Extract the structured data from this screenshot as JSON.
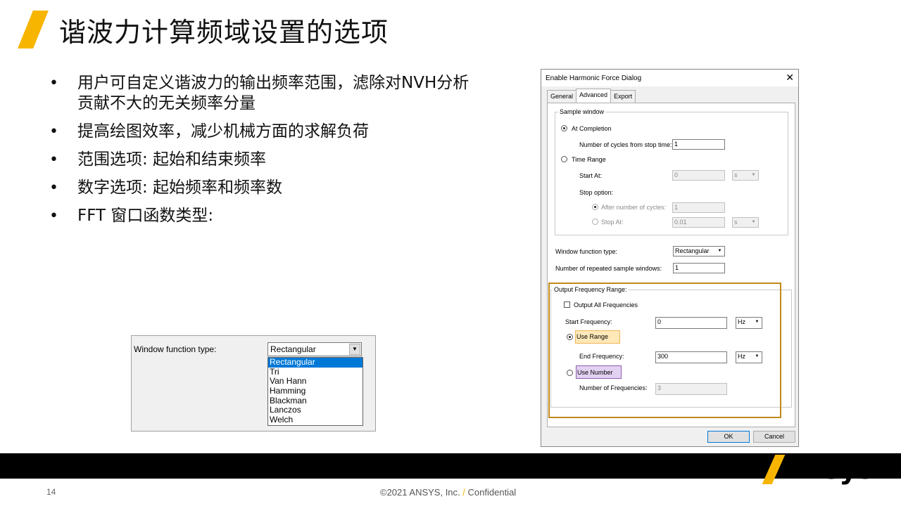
{
  "slide": {
    "title": "谐波力计算频域设置的选项",
    "bullets": [
      "用户可自定义谐波力的输出频率范围，滤除对NVH分析贡献不大的无关频率分量",
      "提高绘图效率，减少机械方面的求解负荷",
      "范围选项: 起始和结束频率",
      "数字选项: 起始频率和频率数",
      "FFT 窗口函数类型:"
    ]
  },
  "dropdown_snapshot": {
    "label": "Window function type:",
    "selected": "Rectangular",
    "options": [
      "Rectangular",
      "Tri",
      "Van Hann",
      "Hamming",
      "Blackman",
      "Lanczos",
      "Welch"
    ]
  },
  "dialog": {
    "title": "Enable Harmonic Force Dialog",
    "close_symbol": "✕",
    "tabs": [
      "General",
      "Advanced",
      "Export"
    ],
    "sample_window": {
      "caption": "Sample window",
      "at_completion": "At Completion",
      "cycles_label": "Number of cycles from stop time:",
      "cycles_value": "1",
      "time_range": "Time Range",
      "start_at_label": "Start At:",
      "start_at_value": "0",
      "start_unit": "s",
      "stop_option_label": "Stop option:",
      "after_cycles": "After number of cycles:",
      "after_cycles_value": "1",
      "stop_at": "Stop At:",
      "stop_at_value": "0.01",
      "stop_unit": "s"
    },
    "window_function_label": "Window function type:",
    "window_function_value": "Rectangular",
    "repeated_label": "Number of repeated sample windows:",
    "repeated_value": "1",
    "output_range": {
      "caption": "Output Frequency Range:",
      "output_all": "Output All Frequencies",
      "start_freq_label": "Start Frequency:",
      "start_freq_value": "0",
      "start_unit": "Hz",
      "use_range": "Use Range",
      "end_freq_label": "End Frequency:",
      "end_freq_value": "300",
      "end_unit": "Hz",
      "use_number": "Use Number",
      "num_freq_label": "Number of Frequencies:",
      "num_freq_value": "3"
    },
    "ok": "OK",
    "cancel": "Cancel"
  },
  "footer": {
    "page_number": "14",
    "copyright": "©2021 ANSYS, Inc.",
    "slash": "/",
    "confidential": "Confidential",
    "logo": "Ansys"
  },
  "colors": {
    "accent": "#f7b500",
    "highlight_orange": "#ffe8b8",
    "highlight_purple": "#e3d1f2",
    "frame": "#c08a1a"
  }
}
